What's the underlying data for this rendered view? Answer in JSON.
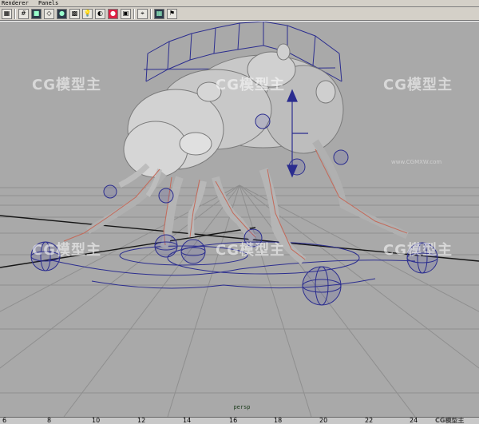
{
  "menubar": {
    "items": [
      "Renderer",
      "Panels"
    ]
  },
  "toolbar": {
    "icons": [
      "panel-layout-icon",
      "grid-icon",
      "camera-icon",
      "wireframe-icon",
      "smooth-shade-icon",
      "texture-icon",
      "light-icon",
      "shadow-icon",
      "render-icon",
      "isolate-icon",
      "select-icon",
      "resolution-gate-icon",
      "hud-icon"
    ]
  },
  "viewport": {
    "camera_label": "persp",
    "watermarks": [
      "CG模型主",
      "CG模型主",
      "CG模型主",
      "CG模型主",
      "CG模型主",
      "CG模型主"
    ],
    "watermark_url": "www.CGMXW.com",
    "colors": {
      "background": "#a9a9a9",
      "grid": "#8e8e8e",
      "axis": "#1a1a1a",
      "model": "#c9c9c9",
      "controls": "#2b2d8f",
      "joints": "#c46a5a"
    }
  },
  "ruler": {
    "ticks": [
      "6",
      "8",
      "10",
      "12",
      "14",
      "16",
      "18",
      "20",
      "22",
      "24"
    ],
    "end_watermark": "CG模型主"
  }
}
